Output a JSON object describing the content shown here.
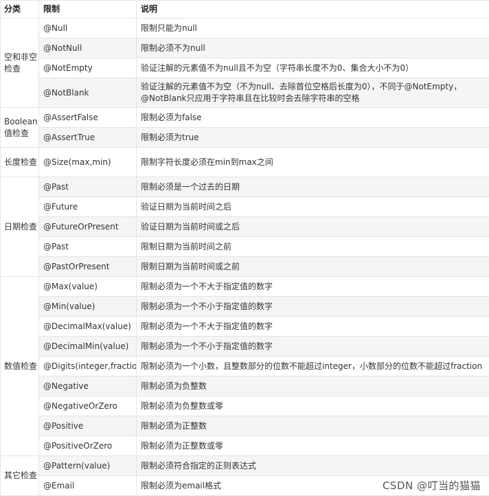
{
  "header": {
    "category": "分类",
    "constraint": "限制",
    "description": "说明"
  },
  "groups": {
    "g1": "空和非空检查",
    "g2": "Boolean值检查",
    "g3": "长度检查",
    "g4": "日期检查",
    "g5": "数值检查",
    "g6": "其它检查"
  },
  "rows": [
    {
      "name": "@Null",
      "desc": "限制只能为null"
    },
    {
      "name": "@NotNull",
      "desc": "限制必须不为null"
    },
    {
      "name": "@NotEmpty",
      "desc": "验证注解的元素值不为null且不为空（字符串长度不为0、集合大小不为0）"
    },
    {
      "name": "@NotBlank",
      "desc": "验证注解的元素值不为空（不为null、去除首位空格后长度为0），不同于@NotEmpty，@NotBlank只应用于字符串且在比较时会去除字符串的空格"
    },
    {
      "name": "@AssertFalse",
      "desc": "限制必须为false"
    },
    {
      "name": "@AssertTrue",
      "desc": "限制必须为true"
    },
    {
      "name": "@Size(max,min)",
      "desc": "限制字符长度必须在min到max之间"
    },
    {
      "name": "@Past",
      "desc": "限制必须是一个过去的日期"
    },
    {
      "name": "@Future",
      "desc": "验证日期为当前时间之后"
    },
    {
      "name": "@FutureOrPresent",
      "desc": "验证日期为当前时间或之后"
    },
    {
      "name": "@Past",
      "desc": "限制日期为当前时间之前"
    },
    {
      "name": "@PastOrPresent",
      "desc": "限制日期为当前时间或之前"
    },
    {
      "name": "@Max(value)",
      "desc": "限制必须为一个不大于指定值的数字"
    },
    {
      "name": "@Min(value)",
      "desc": "限制必须为一个不小于指定值的数字"
    },
    {
      "name": "@DecimalMax(value)",
      "desc": "限制必须为一个不大于指定值的数字"
    },
    {
      "name": "@DecimalMin(value)",
      "desc": "限制必须为一个不小于指定值的数字"
    },
    {
      "name": "@Digits(integer,fraction)",
      "desc": "限制必须为一个小数，且整数部分的位数不能超过integer，小数部分的位数不能超过fraction"
    },
    {
      "name": "@Negative",
      "desc": "限制必须为负整数"
    },
    {
      "name": "@NegativeOrZero",
      "desc": "限制必须为负整数或零"
    },
    {
      "name": "@Positive",
      "desc": "限制必须为正整数"
    },
    {
      "name": "@PositiveOrZero",
      "desc": "限制必须为正整数或零"
    },
    {
      "name": "@Pattern(value)",
      "desc": "限制必须符合指定的正则表达式"
    },
    {
      "name": "@Email",
      "desc": "限制必须为email格式"
    }
  ],
  "watermark": "CSDN @叮当的猫猫"
}
